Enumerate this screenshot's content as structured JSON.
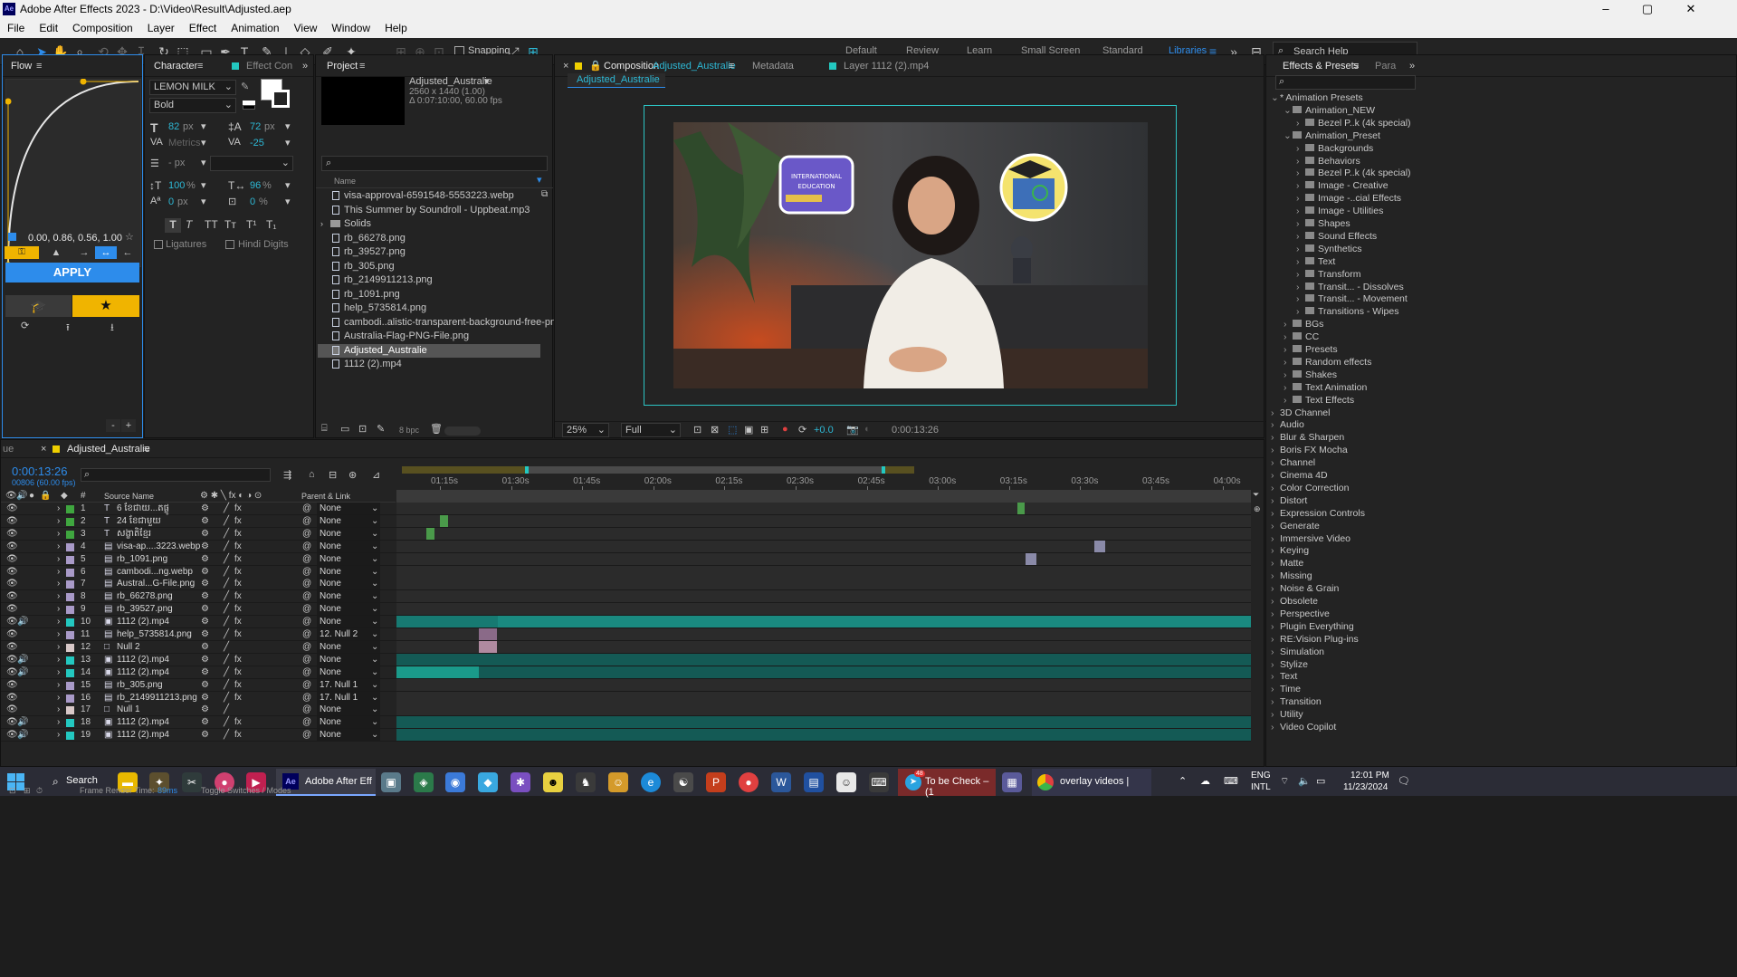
{
  "app": {
    "title": "Adobe After Effects 2023 - D:\\Video\\Result\\Adjusted.aep"
  },
  "menu": [
    "File",
    "Edit",
    "Composition",
    "Layer",
    "Effect",
    "Animation",
    "View",
    "Window",
    "Help"
  ],
  "toolbar": {
    "snapping": "Snapping",
    "workspaces": [
      "Default",
      "Review",
      "Learn",
      "Small Screen",
      "Standard",
      "Libraries"
    ],
    "search": "Search Help"
  },
  "flow": {
    "tab": "Flow",
    "curve": "0.00, 0.86, 0.56, 1.00",
    "apply": "APPLY",
    "plus": "+",
    "minus": "-"
  },
  "character": {
    "tab": "Character",
    "tab2": "Effect Con",
    "font": "LEMON MILK",
    "style": "Bold",
    "size": "82",
    "size_unit": "px",
    "leading": "72",
    "leading_unit": "px",
    "kerning": "Metrics",
    "tracking": "-25",
    "stroke": "- px",
    "vscale": "100",
    "hscale": "96",
    "baseline": "0",
    "tsume": "0",
    "px": "px",
    "pct": "%",
    "ligatures": "Ligatures",
    "hindi": "Hindi Digits"
  },
  "project": {
    "tab": "Project",
    "comp_name": "Adjusted_Australie",
    "comp_res": "2560 x 1440 (1.00)",
    "comp_dur": "Δ 0:07:10:00, 60.00 fps",
    "col_name": "Name",
    "bpc": "8 bpc",
    "items": [
      "visa-approval-6591548-5553223.webp",
      "This Summer by Soundroll - Uppbeat.mp3",
      "Solids",
      "rb_66278.png",
      "rb_39527.png",
      "rb_305.png",
      "rb_2149911213.png",
      "rb_1091.png",
      "help_5735814.png",
      "cambodi..alistic-transparent-background-free-png.wet",
      "Australia-Flag-PNG-File.png",
      "Adjusted_Australie",
      "1112 (2).mp4"
    ]
  },
  "composition": {
    "tab_prefix": "Composition",
    "tab_name": "Adjusted_Australie",
    "metadata": "Metadata",
    "layer_tab": "Layer 1112 (2).mp4",
    "subtab": "Adjusted_Australie",
    "zoom": "25%",
    "res": "Full",
    "exposure": "+0.0",
    "timecode": "0:00:13:26",
    "sticker1_line1": "INTERNATIONAL",
    "sticker1_line2": "EDUCATION"
  },
  "timeline": {
    "tab_left": "ue",
    "tab": "Adjusted_Australie",
    "timecode": "0:00:13:26",
    "frames": "00806 (60.00 fps)",
    "col_source": "Source Name",
    "col_parent": "Parent & Link",
    "ruler": [
      "01:15s",
      "01:30s",
      "01:45s",
      "02:00s",
      "02:15s",
      "02:30s",
      "02:45s",
      "03:00s",
      "03:15s",
      "03:30s",
      "03:45s",
      "04:00s"
    ],
    "layers": [
      {
        "n": "1",
        "name": "6 ខែជាយ...តផ្លូ",
        "type": "T",
        "color": "#3fa63f",
        "parent": "None"
      },
      {
        "n": "2",
        "name": "24 ខែជាមួយ",
        "type": "T",
        "color": "#3fa63f",
        "parent": "None"
      },
      {
        "n": "3",
        "name": "សង្ខាតិខ្មែរ",
        "type": "T",
        "color": "#3fa63f",
        "parent": "None"
      },
      {
        "n": "4",
        "name": "visa-ap....3223.webp",
        "type": "img",
        "color": "#a99ac8",
        "parent": "None"
      },
      {
        "n": "5",
        "name": "rb_1091.png",
        "type": "img",
        "color": "#a99ac8",
        "parent": "None"
      },
      {
        "n": "6",
        "name": "cambodi...ng.webp",
        "type": "img",
        "color": "#a99ac8",
        "parent": "None"
      },
      {
        "n": "7",
        "name": "Austral...G-File.png",
        "type": "img",
        "color": "#a99ac8",
        "parent": "None"
      },
      {
        "n": "8",
        "name": "rb_66278.png",
        "type": "img",
        "color": "#a99ac8",
        "parent": "None"
      },
      {
        "n": "9",
        "name": "rb_39527.png",
        "type": "img",
        "color": "#a99ac8",
        "parent": "None"
      },
      {
        "n": "10",
        "name": "1112 (2).mp4",
        "type": "vid",
        "color": "#23c8c0",
        "parent": "None"
      },
      {
        "n": "11",
        "name": "help_5735814.png",
        "type": "img",
        "color": "#a99ac8",
        "parent": "12. Null 2"
      },
      {
        "n": "12",
        "name": "Null 2",
        "type": "null",
        "color": "#d8c8c8",
        "parent": "None"
      },
      {
        "n": "13",
        "name": "1112 (2).mp4",
        "type": "vid",
        "color": "#23c8c0",
        "parent": "None"
      },
      {
        "n": "14",
        "name": "1112 (2).mp4",
        "type": "vid",
        "color": "#23c8c0",
        "parent": "None"
      },
      {
        "n": "15",
        "name": "rb_305.png",
        "type": "img",
        "color": "#a99ac8",
        "parent": "17. Null 1"
      },
      {
        "n": "16",
        "name": "rb_2149911213.png",
        "type": "img",
        "color": "#a99ac8",
        "parent": "17. Null 1"
      },
      {
        "n": "17",
        "name": "Null 1",
        "type": "null",
        "color": "#d8c8c8",
        "parent": "None"
      },
      {
        "n": "18",
        "name": "1112 (2).mp4",
        "type": "vid",
        "color": "#23c8c0",
        "parent": "None"
      },
      {
        "n": "19",
        "name": "1112 (2).mp4",
        "type": "vid",
        "color": "#23c8c0",
        "parent": "None"
      }
    ],
    "footer_left": "Frame Render Time:",
    "footer_val": "89ms",
    "footer_mid": "Toggle Switches / Modes"
  },
  "effects": {
    "tab": "Effects & Presets",
    "tab2": "Para",
    "tree": [
      {
        "t": "* Animation Presets",
        "d": 0,
        "open": true
      },
      {
        "t": "Animation_NEW",
        "d": 1,
        "open": true
      },
      {
        "t": "Bezel P..k (4k special)",
        "d": 2
      },
      {
        "t": "Animation_Preset",
        "d": 1,
        "open": true
      },
      {
        "t": "Backgrounds",
        "d": 2
      },
      {
        "t": "Behaviors",
        "d": 2
      },
      {
        "t": "Bezel P..k (4k special)",
        "d": 2
      },
      {
        "t": "Image - Creative",
        "d": 2
      },
      {
        "t": "Image -..cial Effects",
        "d": 2
      },
      {
        "t": "Image - Utilities",
        "d": 2
      },
      {
        "t": "Shapes",
        "d": 2
      },
      {
        "t": "Sound Effects",
        "d": 2
      },
      {
        "t": "Synthetics",
        "d": 2
      },
      {
        "t": "Text",
        "d": 2
      },
      {
        "t": "Transform",
        "d": 2
      },
      {
        "t": "Transit... - Dissolves",
        "d": 2
      },
      {
        "t": "Transit... - Movement",
        "d": 2
      },
      {
        "t": "Transitions - Wipes",
        "d": 2
      },
      {
        "t": "BGs",
        "d": 1
      },
      {
        "t": "CC",
        "d": 1
      },
      {
        "t": "Presets",
        "d": 1
      },
      {
        "t": "Random effects",
        "d": 1
      },
      {
        "t": "Shakes",
        "d": 1
      },
      {
        "t": "Text Animation",
        "d": 1
      },
      {
        "t": "Text Effects",
        "d": 1
      },
      {
        "t": "3D Channel",
        "d": 0
      },
      {
        "t": "Audio",
        "d": 0
      },
      {
        "t": "Blur & Sharpen",
        "d": 0
      },
      {
        "t": "Boris FX Mocha",
        "d": 0
      },
      {
        "t": "Channel",
        "d": 0
      },
      {
        "t": "Cinema 4D",
        "d": 0
      },
      {
        "t": "Color Correction",
        "d": 0
      },
      {
        "t": "Distort",
        "d": 0
      },
      {
        "t": "Expression Controls",
        "d": 0
      },
      {
        "t": "Generate",
        "d": 0
      },
      {
        "t": "Immersive Video",
        "d": 0
      },
      {
        "t": "Keying",
        "d": 0
      },
      {
        "t": "Matte",
        "d": 0
      },
      {
        "t": "Missing",
        "d": 0
      },
      {
        "t": "Noise & Grain",
        "d": 0
      },
      {
        "t": "Obsolete",
        "d": 0
      },
      {
        "t": "Perspective",
        "d": 0
      },
      {
        "t": "Plugin Everything",
        "d": 0
      },
      {
        "t": "RE:Vision Plug-ins",
        "d": 0
      },
      {
        "t": "Simulation",
        "d": 0
      },
      {
        "t": "Stylize",
        "d": 0
      },
      {
        "t": "Text",
        "d": 0
      },
      {
        "t": "Time",
        "d": 0
      },
      {
        "t": "Transition",
        "d": 0
      },
      {
        "t": "Utility",
        "d": 0
      },
      {
        "t": "Video Copilot",
        "d": 0
      }
    ]
  },
  "taskbar": {
    "search": "Search",
    "ae": "Adobe After Eff",
    "telegram_badge": "48",
    "telegram": "To be Check – (1",
    "chrome": "overlay videos |",
    "lang1": "ENG",
    "lang2": "INTL",
    "time": "12:01 PM",
    "date": "11/23/2024"
  }
}
